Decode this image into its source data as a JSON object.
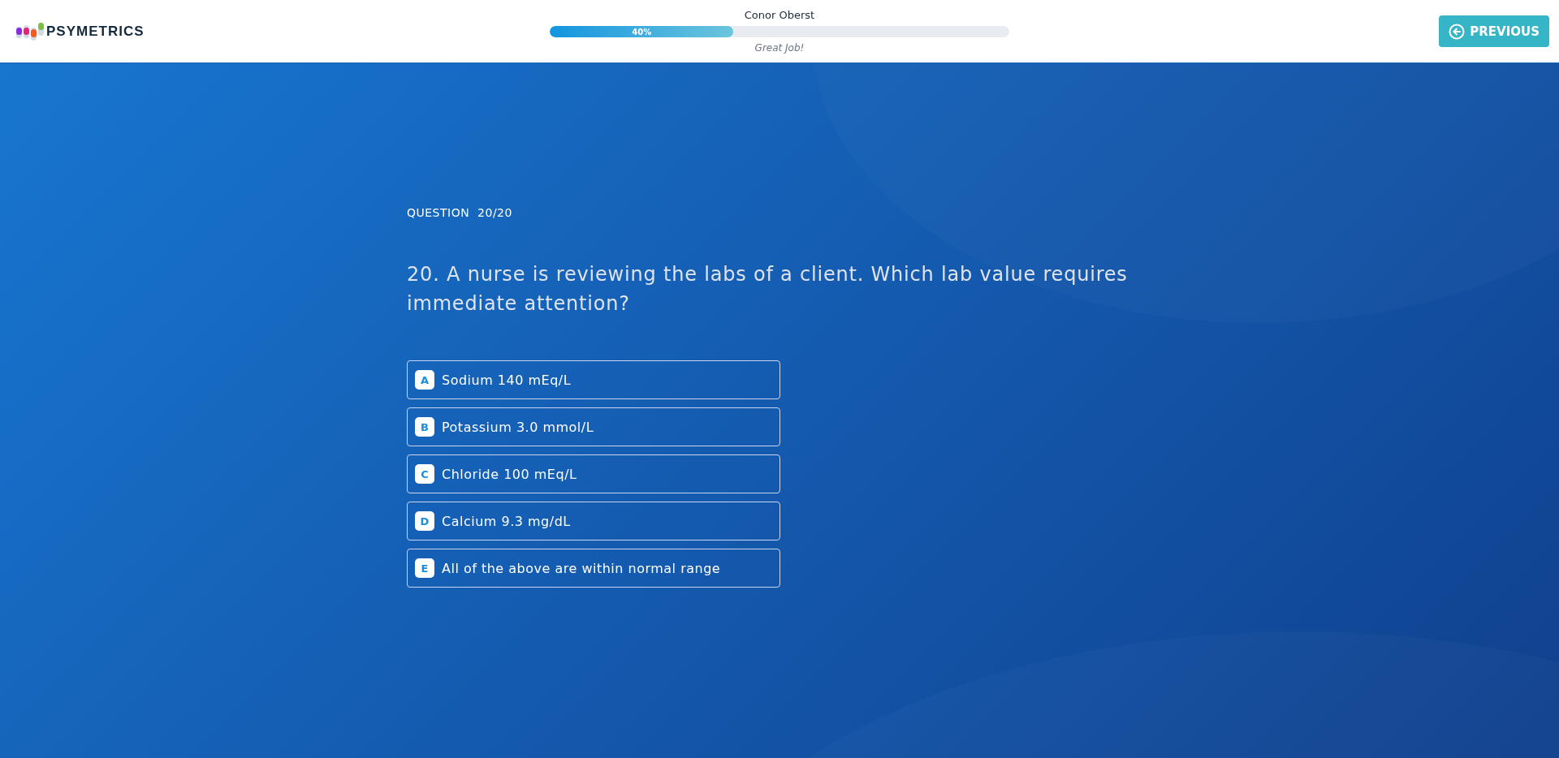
{
  "header": {
    "logo": "PSYMETRICS",
    "user_name": "Conor Oberst",
    "progress": {
      "level": 0.4,
      "label": "40%"
    },
    "message": "Great Job!",
    "previous_button": "PREVIOUS"
  },
  "question": {
    "counter": "QUESTION  20/20",
    "text": "20. A nurse is reviewing the labs of a client. Which lab value requires immediate attention?",
    "options": [
      {
        "letter": "A",
        "text": "Sodium 140 mEq/L",
        "selected": false
      },
      {
        "letter": "B",
        "text": "Potassium 3.0 mmol/L",
        "selected": false
      },
      {
        "letter": "C",
        "text": "Chloride 100 mEq/L",
        "selected": false
      },
      {
        "letter": "D",
        "text": "Calcium 9.3 mg/dL",
        "selected": false
      },
      {
        "letter": "E",
        "text": "All of the above are within normal range",
        "selected": false
      }
    ]
  }
}
